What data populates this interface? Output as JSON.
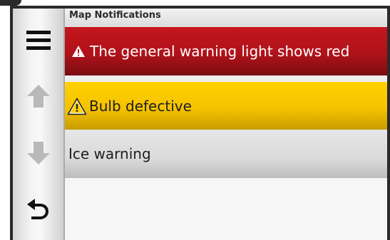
{
  "header": {
    "title": "Map Notifications"
  },
  "sidebar": {
    "menu_icon": "menu-icon",
    "up_icon": "arrow-up-icon",
    "down_icon": "arrow-down-icon",
    "back_icon": "back-icon"
  },
  "notifications": [
    {
      "label": "The general warning light shows red",
      "severity": "critical",
      "color": "#b0121a",
      "icon": "warning-icon"
    },
    {
      "label": "Bulb defective",
      "severity": "warning",
      "color": "#f5c200",
      "icon": "warning-icon"
    },
    {
      "label": "Ice warning",
      "severity": "info",
      "color": "#dadada",
      "icon": ""
    }
  ]
}
